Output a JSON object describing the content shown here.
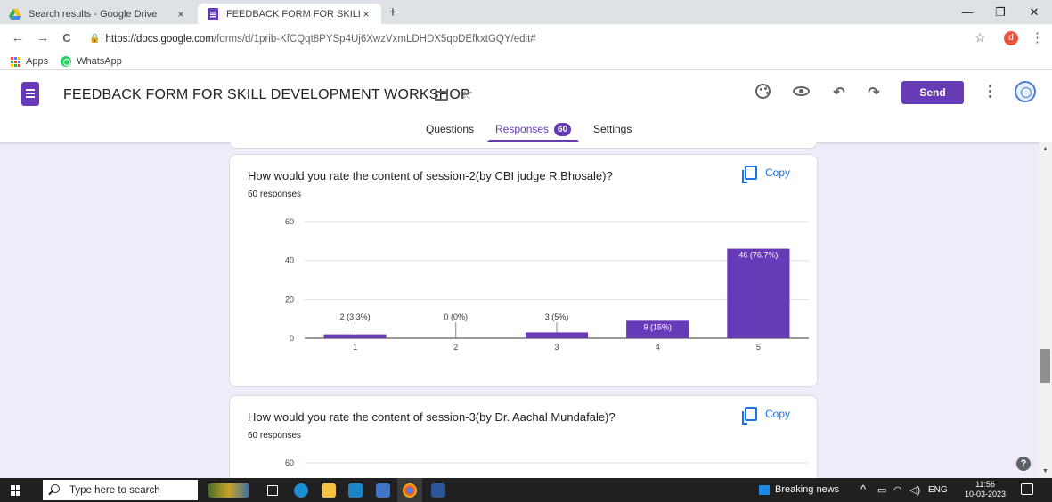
{
  "browser": {
    "tabs": [
      {
        "title": "Search results - Google Drive",
        "close": "×"
      },
      {
        "title": "FEEDBACK FORM FOR SKILL DEVE",
        "close": "×"
      }
    ],
    "new_tab": "+",
    "window_controls": {
      "minimize": "—",
      "restore": "❐",
      "close": "✕"
    },
    "nav": {
      "back": "←",
      "forward": "→",
      "reload": "C"
    },
    "url": {
      "host": "https://docs.google.com",
      "path": "/forms/d/1prib-KfCQqt8PYSp4Uj6XwzVxmLDHDX5qoDEfkxtGQY/edit#"
    },
    "bookmark_star": "☆",
    "profile_initial": "d",
    "menu": "⋮",
    "bookmarks": [
      {
        "label": "Apps"
      },
      {
        "label": "WhatsApp"
      }
    ]
  },
  "forms_header": {
    "title": "FEEDBACK FORM FOR SKILL DEVELOPMENT WORKSHOP",
    "star": "☆",
    "undo": "↶",
    "redo": "↷",
    "send_label": "Send",
    "more": "⋮",
    "tabs": {
      "questions": "Questions",
      "responses": "Responses",
      "responses_count": "60",
      "settings": "Settings"
    }
  },
  "questions": [
    {
      "text": "How would you rate the content of session-2(by CBI judge R.Bhosale)?",
      "responses": "60 responses",
      "copy_label": "Copy"
    },
    {
      "text": "How would you rate the content of session-3(by Dr. Aachal Mundafale)?",
      "responses": "60 responses",
      "copy_label": "Copy"
    }
  ],
  "chart_data": [
    {
      "type": "bar",
      "categories": [
        "1",
        "2",
        "3",
        "4",
        "5"
      ],
      "values": [
        2,
        0,
        3,
        9,
        46
      ],
      "labels": [
        "2 (3.3%)",
        "0 (0%)",
        "3 (5%)",
        "9 (15%)",
        "46 (76.7%)"
      ],
      "yticks": [
        "0",
        "20",
        "40",
        "60"
      ],
      "ylim": [
        0,
        60
      ],
      "grid": true,
      "bar_color": "#673ab7"
    },
    {
      "type": "bar",
      "yticks": [
        "60"
      ],
      "ylim": [
        0,
        60
      ],
      "grid": true
    }
  ],
  "taskbar": {
    "search_placeholder": "Type here to search",
    "news": "Breaking news",
    "tray_chevron": "^",
    "lang": "ENG",
    "time": "11:56",
    "date": "10-03-2023",
    "help": "?"
  }
}
